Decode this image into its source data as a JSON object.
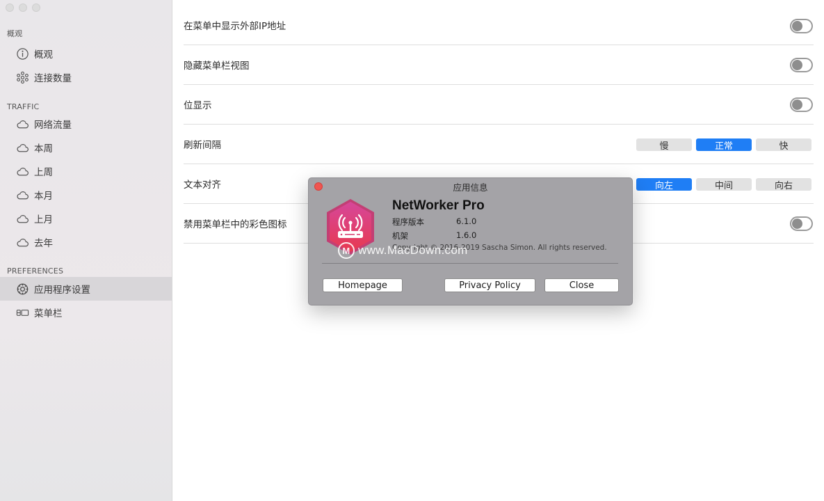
{
  "sidebar": {
    "sections": [
      {
        "header": "概观",
        "items": [
          {
            "label": "概观",
            "icon": "info-circle-icon"
          },
          {
            "label": "连接数量",
            "icon": "connections-icon"
          }
        ]
      },
      {
        "header": "TRAFFIC",
        "items": [
          {
            "label": "网络流量",
            "icon": "cloud-icon"
          },
          {
            "label": "本周",
            "icon": "cloud-icon"
          },
          {
            "label": "上周",
            "icon": "cloud-icon"
          },
          {
            "label": "本月",
            "icon": "cloud-icon"
          },
          {
            "label": "上月",
            "icon": "cloud-icon"
          },
          {
            "label": "去年",
            "icon": "cloud-icon"
          }
        ]
      },
      {
        "header": "PREFERENCES",
        "items": [
          {
            "label": "应用程序设置",
            "icon": "gear-icon",
            "active": true
          },
          {
            "label": "菜单栏",
            "icon": "menubar-icon"
          }
        ]
      }
    ]
  },
  "settings": {
    "show_external_ip": {
      "label": "在菜单中显示外部IP地址",
      "on": false
    },
    "hide_menubar_view": {
      "label": "隐藏菜单栏视图",
      "on": false
    },
    "bit_display": {
      "label": "位显示",
      "on": false
    },
    "refresh_interval": {
      "label": "刷新间隔",
      "options": [
        "慢",
        "正常",
        "快"
      ],
      "selected": "正常"
    },
    "text_align": {
      "label": "文本对齐",
      "options": [
        "向左",
        "中间",
        "向右"
      ],
      "selected": "向左"
    },
    "disable_color_icons": {
      "label": "禁用菜单栏中的彩色图标",
      "on": false
    }
  },
  "dialog": {
    "title": "应用信息",
    "app_name": "NetWorker Pro",
    "version_label": "程序版本",
    "version_value": "6.1.0",
    "arch_label": "机架",
    "arch_value": "1.6.0",
    "copyright": "Copyright © 2016-2019 Sascha Simon. All rights reserved.",
    "watermark": "www.MacDown.com",
    "watermark_logo": "M",
    "buttons": {
      "homepage": "Homepage",
      "privacy": "Privacy Policy",
      "close": "Close"
    }
  },
  "colors": {
    "accent": "#1f7ef5",
    "close_dot": "#f05550",
    "icon_gradient_top": "#d6479a",
    "icon_gradient_bottom": "#e8394f"
  }
}
